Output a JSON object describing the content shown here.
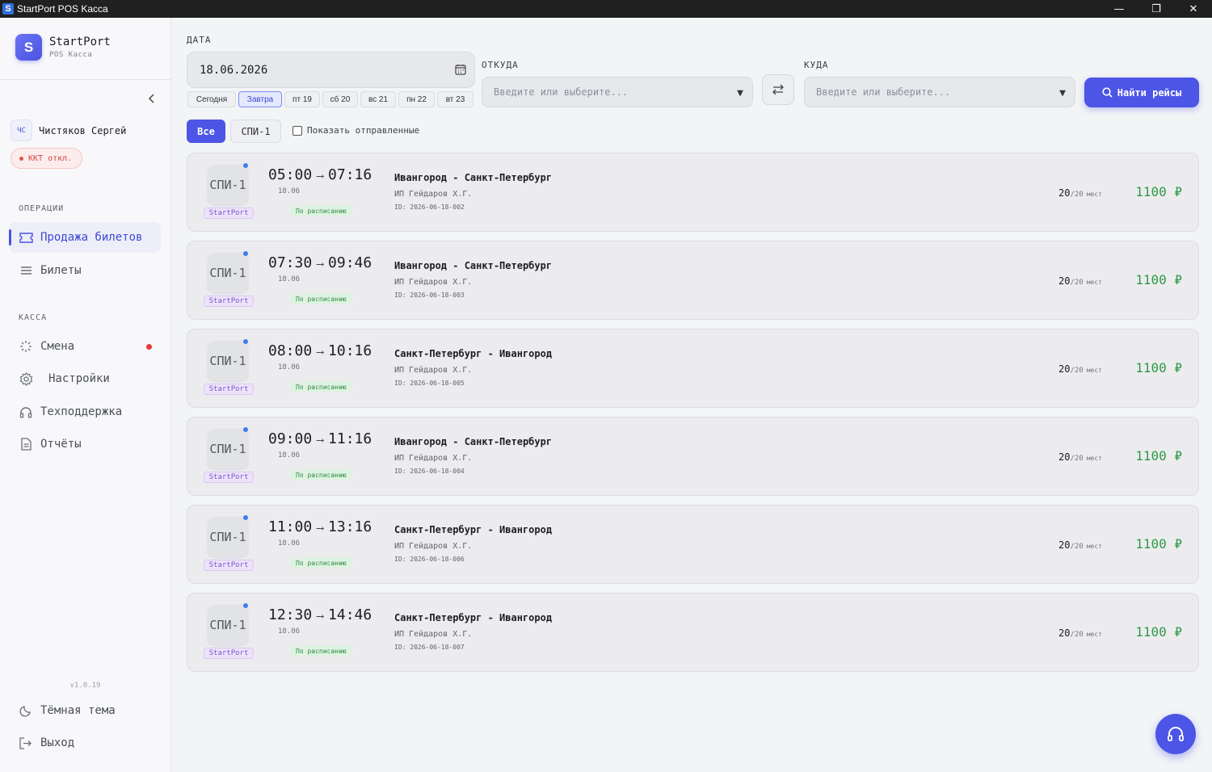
{
  "window": {
    "title": "StartPort POS Kacca"
  },
  "brand": {
    "name": "StartPort",
    "sub": "POS Касса"
  },
  "user": {
    "initials": "ЧС",
    "name": "Чистяков Сергей"
  },
  "kkt": {
    "label": "ККТ откл."
  },
  "sidebar": {
    "operations_label": "ОПЕРАЦИИ",
    "operations": [
      {
        "label": "Продажа билетов",
        "icon": "ticket-icon"
      },
      {
        "label": "Билеты",
        "icon": "list-icon"
      }
    ],
    "cash_label": "КАССА",
    "cash": [
      {
        "label": "Смена",
        "icon": "loader-icon"
      },
      {
        "label": "Настройки",
        "icon": "gear-icon"
      },
      {
        "label": "Техподдержка",
        "icon": "headset-icon"
      },
      {
        "label": "Отчёты",
        "icon": "document-icon"
      }
    ],
    "version": "v1.0.19",
    "dark_theme": "Тёмная тема",
    "logout": "Выход"
  },
  "search": {
    "date_label": "ДАТА",
    "date_value": "18.06.2026",
    "quick_dates": [
      "Сегодня",
      "Завтра",
      "пт 19",
      "сб 20",
      "вс 21",
      "пн 22",
      "вт 23"
    ],
    "from_label": "ОТКУДА",
    "from_placeholder": "Введите или выберите...",
    "to_label": "КУДА",
    "to_placeholder": "Введите или выберите...",
    "find_label": "Найти рейсы"
  },
  "filters": {
    "all": "Все",
    "chip": "СПИ-1",
    "show_sent": "Показать отправленные"
  },
  "trips": [
    {
      "bus": "СПИ-1",
      "carrier": "StartPort",
      "dep": "05:00",
      "arr": "07:16",
      "date": "18.06",
      "status": "По расписанию",
      "route": "Ивангород - Санкт-Петербург",
      "operator": "ИП Гейдаров Х.Г.",
      "id": "ID: 2026-06-18-002",
      "seats_free": "20",
      "seats_total": "/20",
      "seats_unit": "мест",
      "price": "1100 ₽"
    },
    {
      "bus": "СПИ-1",
      "carrier": "StartPort",
      "dep": "07:30",
      "arr": "09:46",
      "date": "18.06",
      "status": "По расписанию",
      "route": "Ивангород - Санкт-Петербург",
      "operator": "ИП Гейдаров Х.Г.",
      "id": "ID: 2026-06-18-003",
      "seats_free": "20",
      "seats_total": "/20",
      "seats_unit": "мест",
      "price": "1100 ₽"
    },
    {
      "bus": "СПИ-1",
      "carrier": "StartPort",
      "dep": "08:00",
      "arr": "10:16",
      "date": "18.06",
      "status": "По расписанию",
      "route": "Санкт-Петербург - Ивангород",
      "operator": "ИП Гейдаров Х.Г.",
      "id": "ID: 2026-06-18-005",
      "seats_free": "20",
      "seats_total": "/20",
      "seats_unit": "мест",
      "price": "1100 ₽"
    },
    {
      "bus": "СПИ-1",
      "carrier": "StartPort",
      "dep": "09:00",
      "arr": "11:16",
      "date": "18.06",
      "status": "По расписанию",
      "route": "Ивангород - Санкт-Петербург",
      "operator": "ИП Гейдаров Х.Г.",
      "id": "ID: 2026-06-18-004",
      "seats_free": "20",
      "seats_total": "/20",
      "seats_unit": "мест",
      "price": "1100 ₽"
    },
    {
      "bus": "СПИ-1",
      "carrier": "StartPort",
      "dep": "11:00",
      "arr": "13:16",
      "date": "18.06",
      "status": "По расписанию",
      "route": "Санкт-Петербург - Ивангород",
      "operator": "ИП Гейдаров Х.Г.",
      "id": "ID: 2026-06-18-006",
      "seats_free": "20",
      "seats_total": "/20",
      "seats_unit": "мест",
      "price": "1100 ₽"
    },
    {
      "bus": "СПИ-1",
      "carrier": "StartPort",
      "dep": "12:30",
      "arr": "14:46",
      "date": "18.06",
      "status": "По расписанию",
      "route": "Санкт-Петербург - Ивангород",
      "operator": "ИП Гейдаров Х.Г.",
      "id": "ID: 2026-06-18-007",
      "seats_free": "20",
      "seats_total": "/20",
      "seats_unit": "мест",
      "price": "1100 ₽"
    }
  ],
  "colors": {
    "accent": "#4c55e6",
    "price": "#2e9a48",
    "status_bg": "#dff2e2",
    "alert": "#e5393a"
  }
}
